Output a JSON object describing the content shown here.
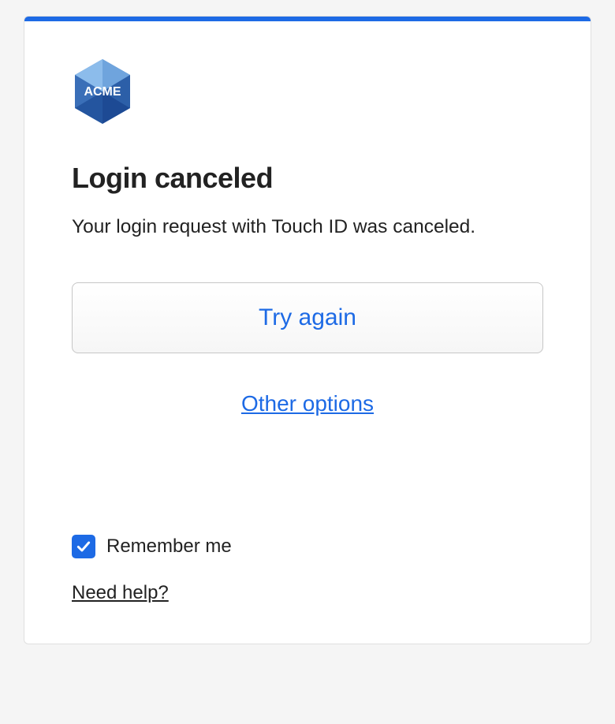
{
  "brand": {
    "name": "ACME"
  },
  "heading": "Login canceled",
  "subtext": "Your login request with Touch ID was canceled.",
  "buttons": {
    "try_again": "Try again",
    "other_options": "Other options"
  },
  "remember": {
    "label": "Remember me",
    "checked": true
  },
  "help_link": "Need help?",
  "colors": {
    "accent": "#1d6ae5"
  }
}
